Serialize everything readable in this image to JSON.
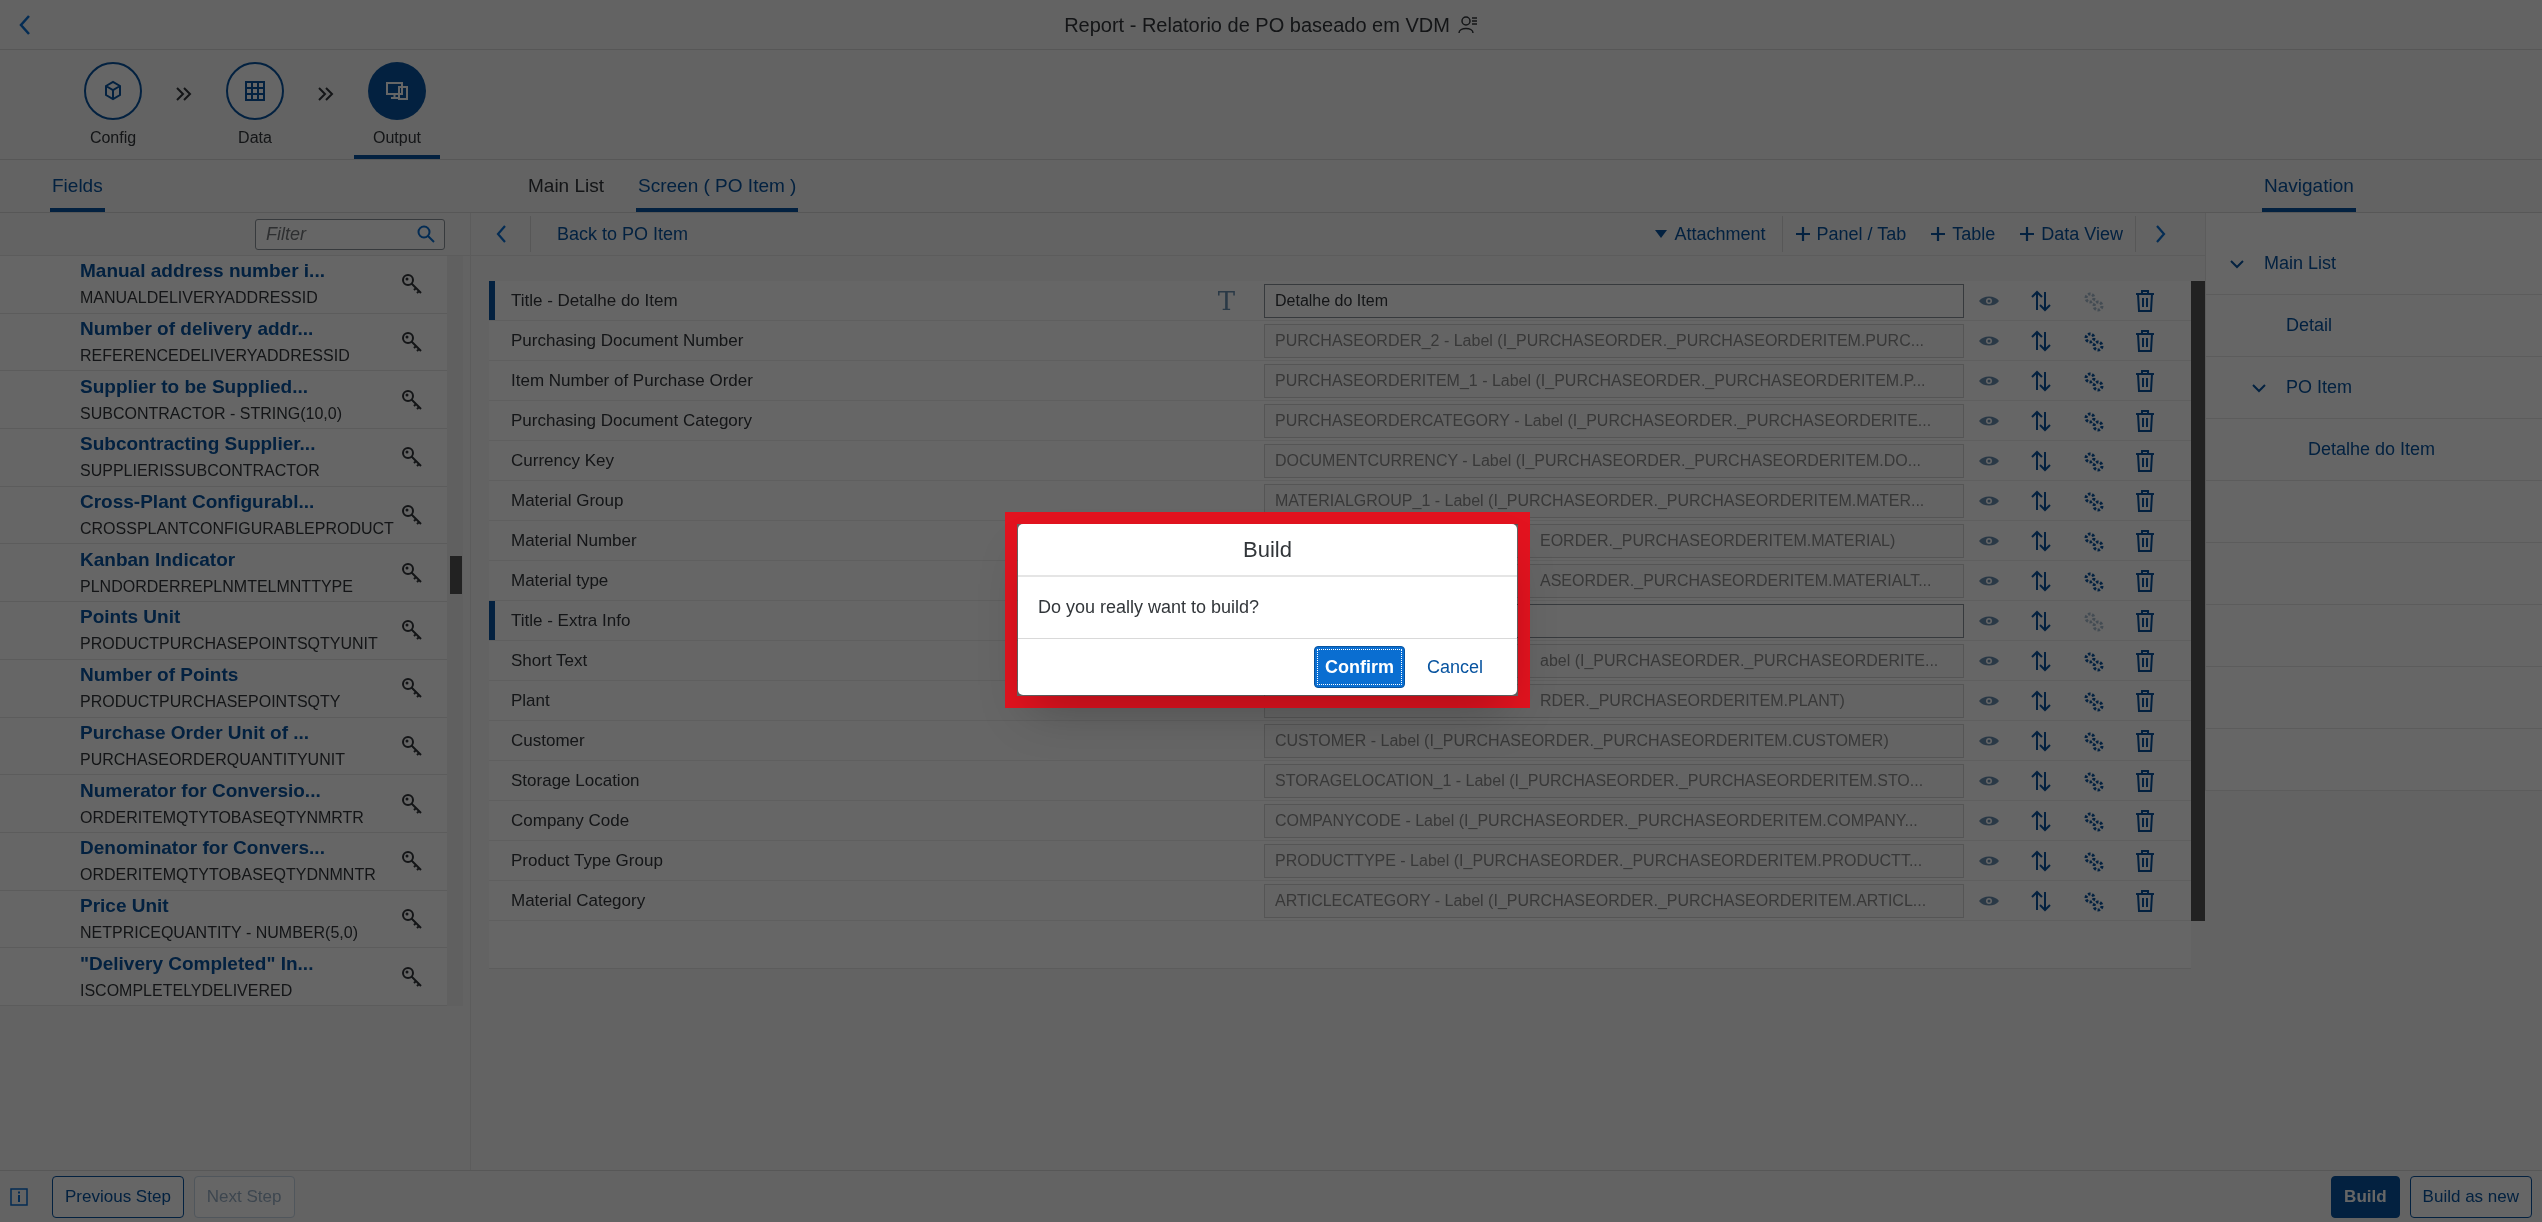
{
  "shell": {
    "title": "Report - Relatorio de PO baseado em VDM"
  },
  "steps": [
    {
      "label": "Config",
      "kind": "config",
      "selected": false
    },
    {
      "label": "Data",
      "kind": "data",
      "selected": false
    },
    {
      "label": "Output",
      "kind": "output",
      "selected": true
    }
  ],
  "fields_panel": {
    "tab": "Fields",
    "filter_placeholder": "Filter",
    "items": [
      {
        "title": "Manual address number i...",
        "name": "MANUALDELIVERYADDRESSID"
      },
      {
        "title": "Number of delivery addr...",
        "name": "REFERENCEDELIVERYADDRESSID"
      },
      {
        "title": "Supplier to be Supplied...",
        "name": "SUBCONTRACTOR - STRING(10,0)"
      },
      {
        "title": "Subcontracting Supplier...",
        "name": "SUPPLIERISSUBCONTRACTOR"
      },
      {
        "title": "Cross-Plant Configurabl...",
        "name": "CROSSPLANTCONFIGURABLEPRODUCT"
      },
      {
        "title": "Kanban Indicator",
        "name": "PLNDORDERREPLNMTELMNTTYPE"
      },
      {
        "title": "Points Unit",
        "name": "PRODUCTPURCHASEPOINTSQTYUNIT"
      },
      {
        "title": "Number of Points",
        "name": "PRODUCTPURCHASEPOINTSQTY"
      },
      {
        "title": "Purchase Order Unit of ...",
        "name": "PURCHASEORDERQUANTITYUNIT"
      },
      {
        "title": "Numerator for Conversio...",
        "name": "ORDERITEMQTYTOBASEQTYNMRTR"
      },
      {
        "title": "Denominator for Convers...",
        "name": "ORDERITEMQTYTOBASEQTYDNMNTR"
      },
      {
        "title": "Price Unit",
        "name": "NETPRICEQUANTITY - NUMBER(5,0)"
      },
      {
        "title": "\"Delivery Completed\" In...",
        "name": "ISCOMPLETELYDELIVERED"
      }
    ]
  },
  "screen": {
    "tabs": [
      {
        "label": "Main List",
        "selected": false
      },
      {
        "label": "Screen ( PO Item )",
        "selected": true
      }
    ],
    "back": "Back to PO Item",
    "actions": [
      {
        "label": "Attachment",
        "kind": "menu"
      },
      {
        "label": "Panel / Tab",
        "kind": "add"
      },
      {
        "label": "Table",
        "kind": "add"
      },
      {
        "label": "Data View",
        "kind": "add"
      }
    ],
    "rows": [
      {
        "label": "Title - Detalhe do Item",
        "kind": "title",
        "covered": false,
        "type_icon": "T",
        "value": "Detalhe do Item"
      },
      {
        "label": "Purchasing Document Number",
        "kind": "field",
        "covered": false,
        "value": "PURCHASEORDER_2 - Label (I_PURCHASEORDER._PURCHASEORDERITEM.PURC..."
      },
      {
        "label": "Item Number of Purchase Order",
        "kind": "field",
        "covered": false,
        "value": "PURCHASEORDERITEM_1 - Label (I_PURCHASEORDER._PURCHASEORDERITEM.P..."
      },
      {
        "label": "Purchasing Document Category",
        "kind": "field",
        "covered": false,
        "value": "PURCHASEORDERCATEGORY - Label (I_PURCHASEORDER._PURCHASEORDERITE..."
      },
      {
        "label": "Currency Key",
        "kind": "field",
        "covered": false,
        "value": "DOCUMENTCURRENCY - Label (I_PURCHASEORDER._PURCHASEORDERITEM.DO..."
      },
      {
        "label": "Material Group",
        "kind": "field",
        "covered": false,
        "value": "MATERIALGROUP_1 - Label (I_PURCHASEORDER._PURCHASEORDERITEM.MATER..."
      },
      {
        "label": "Material Number",
        "kind": "field",
        "covered": true,
        "value": "EORDER._PURCHASEORDERITEM.MATERIAL)"
      },
      {
        "label": "Material type",
        "kind": "field",
        "covered": true,
        "value": "ASEORDER._PURCHASEORDERITEM.MATERIALT..."
      },
      {
        "label": "Title - Extra Info",
        "kind": "title"
      },
      {
        "label": "Short Text",
        "kind": "field",
        "covered": true,
        "value": "abel (I_PURCHASEORDER._PURCHASEORDERITE..."
      },
      {
        "label": "Plant",
        "kind": "field",
        "covered": true,
        "value": "RDER._PURCHASEORDERITEM.PLANT)"
      },
      {
        "label": "Customer",
        "kind": "field",
        "covered": false,
        "value": "CUSTOMER - Label (I_PURCHASEORDER._PURCHASEORDERITEM.CUSTOMER)"
      },
      {
        "label": "Storage Location",
        "kind": "field",
        "covered": false,
        "value": "STORAGELOCATION_1 - Label (I_PURCHASEORDER._PURCHASEORDERITEM.STO..."
      },
      {
        "label": "Company Code",
        "kind": "field",
        "covered": false,
        "value": "COMPANYCODE - Label (I_PURCHASEORDER._PURCHASEORDERITEM.COMPANY..."
      },
      {
        "label": "Product Type Group",
        "kind": "field",
        "covered": false,
        "value": "PRODUCTTYPE - Label (I_PURCHASEORDER._PURCHASEORDERITEM.PRODUCTT..."
      },
      {
        "label": "Material Category",
        "kind": "field",
        "covered": false,
        "value": "ARTICLECATEGORY - Label (I_PURCHASEORDER._PURCHASEORDERITEM.ARTICL..."
      }
    ]
  },
  "navigation": {
    "tab": "Navigation",
    "items": [
      {
        "label": "Main List",
        "expanded": true,
        "children": [
          {
            "label": "Detail"
          },
          {
            "label": "PO Item",
            "expanded": true,
            "children": [
              {
                "label": "Detalhe do Item"
              }
            ]
          }
        ]
      }
    ]
  },
  "dialog": {
    "title": "Build",
    "message": "Do you really want to build?",
    "buttons": [
      {
        "label": "Confirm",
        "kind": "emphasized"
      },
      {
        "label": "Cancel",
        "kind": "transparent"
      }
    ]
  },
  "footer": {
    "left": [
      {
        "label": "Previous Step",
        "disabled": false
      },
      {
        "label": "Next Step",
        "disabled": true
      }
    ],
    "right": [
      {
        "label": "Build",
        "kind": "emphasized"
      },
      {
        "label": "Build as new",
        "kind": "default"
      }
    ]
  }
}
